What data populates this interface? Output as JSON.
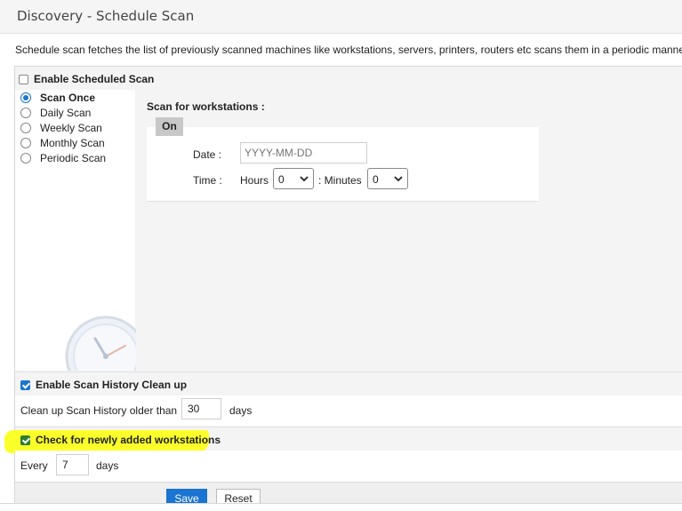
{
  "header": {
    "title": "Discovery - Schedule Scan"
  },
  "description": "Schedule scan fetches the list of previously scanned machines like workstations, servers, printers, routers etc scans them in a periodic manner b",
  "enable_scheduled_scan": {
    "label": "Enable Scheduled Scan",
    "checked": false
  },
  "frequency_options": [
    {
      "label": "Scan Once",
      "selected": true
    },
    {
      "label": "Daily Scan",
      "selected": false
    },
    {
      "label": "Weekly Scan",
      "selected": false
    },
    {
      "label": "Monthly Scan",
      "selected": false
    },
    {
      "label": "Periodic Scan",
      "selected": false
    }
  ],
  "schedule": {
    "heading": "Scan for workstations :",
    "tab_label": "On",
    "date_label": "Date :",
    "date_placeholder": "YYYY-MM-DD",
    "time_label": "Time :",
    "hours_label": "Hours",
    "hours_value": "0",
    "minutes_label": ": Minutes",
    "minutes_value": "0"
  },
  "history_cleanup": {
    "label": "Enable Scan History Clean up",
    "checked": true,
    "older_than_label": "Clean up Scan History older than",
    "days_value": "30",
    "days_unit": "days"
  },
  "new_workstations": {
    "label": "Check for newly added workstations",
    "checked": true,
    "every_label": "Every",
    "days_value": "7",
    "days_unit": "days",
    "highlight_color": "#fbff2a"
  },
  "footer": {
    "save_label": "Save",
    "reset_label": "Reset"
  },
  "colors": {
    "accent": "#1a74d1",
    "checkbox_green": "#2e7d32"
  }
}
